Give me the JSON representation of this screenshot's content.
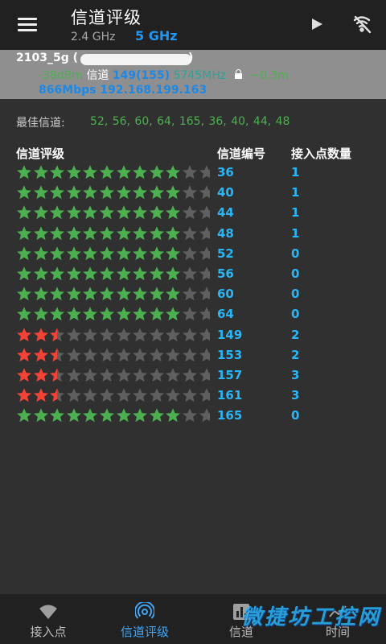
{
  "header": {
    "title": "信道评级",
    "band_24": "2.4 GHz",
    "band_5": "5 GHz",
    "icons": [
      "menu-icon",
      "play-icon",
      "wifi-off-icon"
    ]
  },
  "connected_ap": {
    "ssid": "2103_5g (",
    "ssid_close": ")",
    "signal": "-38dBm",
    "channel_label": "信道",
    "channel": "149(155)",
    "frequency": "5745MHz",
    "distance": "~0.3m",
    "speed": "866Mbps",
    "ip": "192.168.199.163"
  },
  "best_channels": {
    "label": "最佳信道:",
    "values": "52, 56, 60, 64, 165, 36, 40, 44, 48"
  },
  "table": {
    "headers": {
      "rating": "信道评级",
      "channel": "信道编号",
      "ap_count": "接入点数量"
    },
    "rows": [
      {
        "channel": "36",
        "ap_count": "1",
        "rating": 10,
        "color": "#4caf50"
      },
      {
        "channel": "40",
        "ap_count": "1",
        "rating": 10,
        "color": "#4caf50"
      },
      {
        "channel": "44",
        "ap_count": "1",
        "rating": 10,
        "color": "#4caf50"
      },
      {
        "channel": "48",
        "ap_count": "1",
        "rating": 10,
        "color": "#4caf50"
      },
      {
        "channel": "52",
        "ap_count": "0",
        "rating": 10,
        "color": "#4caf50"
      },
      {
        "channel": "56",
        "ap_count": "0",
        "rating": 10,
        "color": "#4caf50"
      },
      {
        "channel": "60",
        "ap_count": "0",
        "rating": 10,
        "color": "#4caf50"
      },
      {
        "channel": "64",
        "ap_count": "0",
        "rating": 10,
        "color": "#4caf50"
      },
      {
        "channel": "149",
        "ap_count": "2",
        "rating": 2.5,
        "color": "#f44336"
      },
      {
        "channel": "153",
        "ap_count": "2",
        "rating": 2.5,
        "color": "#f44336"
      },
      {
        "channel": "157",
        "ap_count": "3",
        "rating": 2.5,
        "color": "#f44336"
      },
      {
        "channel": "161",
        "ap_count": "3",
        "rating": 2.5,
        "color": "#f44336"
      },
      {
        "channel": "165",
        "ap_count": "0",
        "rating": 10,
        "color": "#4caf50"
      }
    ],
    "max_rating": 10,
    "empty_star_color": "#5f5f5f"
  },
  "bottom_nav": {
    "items": [
      {
        "label": "接入点",
        "icon": "wifi-signal-icon",
        "active": false
      },
      {
        "label": "信道评级",
        "icon": "channel-rating-icon",
        "active": true
      },
      {
        "label": "信道",
        "icon": "bar-chart-icon",
        "active": false
      },
      {
        "label": "时间",
        "icon": "line-chart-icon",
        "active": false
      }
    ]
  },
  "watermark": "微捷坊工控网",
  "colors": {
    "accent": "#2196f3",
    "good": "#4caf50",
    "bad": "#f44336",
    "banner_bg": "#8f8f8f"
  }
}
